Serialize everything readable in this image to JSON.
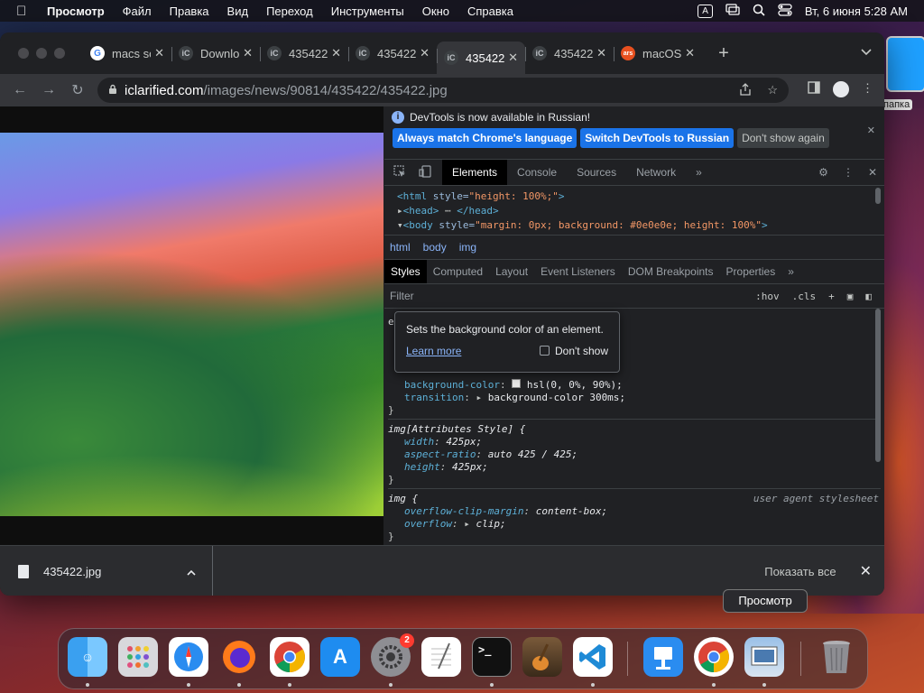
{
  "menubar": {
    "app": "Просмотр",
    "items": [
      "Файл",
      "Правка",
      "Вид",
      "Переход",
      "Инструменты",
      "Окно",
      "Справка"
    ],
    "input_badge": "A",
    "clock": "Вт, 6 июня  5:28 AM"
  },
  "desktop": {
    "folder_label": "папка"
  },
  "tabs": [
    {
      "title": "macs sc",
      "favicon": "google"
    },
    {
      "title": "Downlo",
      "favicon": "site"
    },
    {
      "title": "435422",
      "favicon": "site"
    },
    {
      "title": "435422",
      "favicon": "site"
    },
    {
      "title": "435422",
      "favicon": "site",
      "active": true
    },
    {
      "title": "435422",
      "favicon": "site"
    },
    {
      "title": "macOS",
      "favicon": "ars"
    }
  ],
  "favicon_text": {
    "google": "G",
    "site": "iC",
    "ars": "ars"
  },
  "omnibox": {
    "host": "iclarified.com",
    "path": "/images/news/90814/435422/435422.jpg"
  },
  "devtools": {
    "banner_text": "DevTools is now available in Russian!",
    "btn_match": "Always match Chrome's language",
    "btn_switch": "Switch DevTools to Russian",
    "btn_dont": "Don't show again",
    "tabs": [
      "Elements",
      "Console",
      "Sources",
      "Network"
    ],
    "dom": {
      "line1": {
        "tag_open": "<html ",
        "attr": "style=",
        "val": "\"height: 100%;\"",
        "close": ">"
      },
      "line2": "<head>",
      "line2_end": "</head>",
      "line3": {
        "tag_open": "<body ",
        "attr": "style=",
        "val": "\"margin: 0px; background: #0e0e0e; height: 100%\"",
        "close": ">"
      }
    },
    "breadcrumbs": [
      "html",
      "body",
      "img"
    ],
    "subtabs": [
      "Styles",
      "Computed",
      "Layout",
      "Event Listeners",
      "DOM Breakpoints",
      "Properties"
    ],
    "filter_placeholder": "Filter",
    "hov": ":hov",
    "cls": ".cls",
    "styles": {
      "element_style": "element.style {",
      "bg_prop": "background-color",
      "bg_val": "hsl(0, 0%, 90%);",
      "transition_prop": "transition",
      "transition_val": "background-color 300ms;",
      "attr_sel": "img[Attributes Style] {",
      "attr_props": [
        {
          "p": "width",
          "v": "425px;"
        },
        {
          "p": "aspect-ratio",
          "v": "auto 425 / 425;"
        },
        {
          "p": "height",
          "v": "425px;"
        }
      ],
      "img_sel": "img {",
      "ua_label": "user agent stylesheet",
      "img_props": [
        {
          "p": "overflow-clip-margin",
          "v": "content-box;"
        },
        {
          "p": "overflow",
          "v": "clip;"
        }
      ],
      "close": "}"
    },
    "tooltip": {
      "message": "Sets the background color of an element.",
      "learn": "Learn more",
      "dont_show": "Don't show"
    }
  },
  "download": {
    "file": "435422.jpg",
    "show_all": "Показать все"
  },
  "dock_tooltip": "Просмотр",
  "dock": {
    "badge": "2",
    "apps": [
      "finder-icon",
      "launchpad-icon",
      "safari-icon",
      "firefox-icon",
      "chrome-icon",
      "app-store-icon",
      "system-settings-icon",
      "textedit-icon",
      "terminal-icon",
      "garageband-icon",
      "vscode-icon",
      "keynote-icon",
      "chrome-icon",
      "preview-icon",
      "trash-icon"
    ]
  }
}
